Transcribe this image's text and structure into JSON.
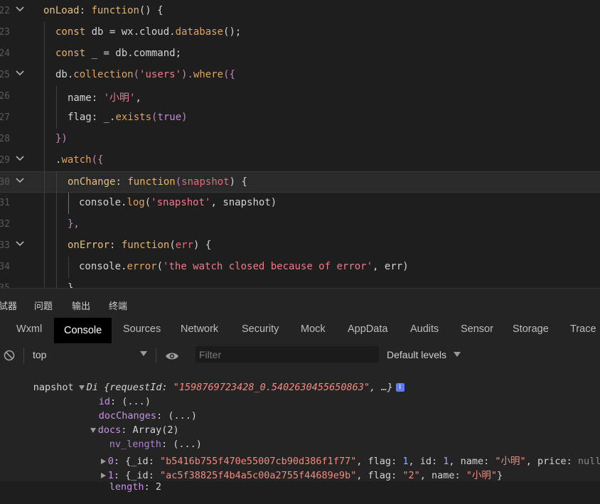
{
  "editor": {
    "lines": [
      {
        "num": "22",
        "fold": true
      },
      {
        "num": "23",
        "fold": false
      },
      {
        "num": "24",
        "fold": false
      },
      {
        "num": "25",
        "fold": true
      },
      {
        "num": "26",
        "fold": false
      },
      {
        "num": "27",
        "fold": false
      },
      {
        "num": "28",
        "fold": false
      },
      {
        "num": "29",
        "fold": true
      },
      {
        "num": "30",
        "fold": true
      },
      {
        "num": "31",
        "fold": false
      },
      {
        "num": "32",
        "fold": false
      },
      {
        "num": "33",
        "fold": true
      },
      {
        "num": "34",
        "fold": false
      },
      {
        "num": "35",
        "fold": false
      }
    ],
    "code": {
      "l22a": "onLoad",
      "l22b": ": ",
      "l22c": "function",
      "l22d": "() {",
      "l23a": "const",
      "l23b": " db = wx.cloud.",
      "l23c": "database",
      "l23d": "();",
      "l24a": "const",
      "l24b": " _ = db.command;",
      "l25a": "db.",
      "l25b": "collection",
      "l25c": "(",
      "l25d": "'users'",
      "l25e": ").",
      "l25f": "where",
      "l25g": "({",
      "l26a": "name: ",
      "l26b": "'小明'",
      "l26c": ",",
      "l27a": "flag: _.",
      "l27b": "exists",
      "l27c": "(",
      "l27d": "true",
      "l27e": ")",
      "l28a": "})",
      "l29a": ".",
      "l29b": "watch",
      "l29c": "({",
      "l30a": "onChange",
      "l30b": ": ",
      "l30c": "function",
      "l30d": "(",
      "l30e": "snapshot",
      "l30f": ") {",
      "l31a": "console.",
      "l31b": "log",
      "l31c": "(",
      "l31d": "'snapshot'",
      "l31e": ", snapshot)",
      "l32a": "},",
      "l33a": "onError",
      "l33b": ": ",
      "l33c": "function",
      "l33d": "(",
      "l33e": "err",
      "l33f": ") {",
      "l34a": "console.",
      "l34b": "error",
      "l34c": "(",
      "l34d": "'the watch closed because of error'",
      "l34e": ", err)",
      "l35a": "}"
    }
  },
  "panel": {
    "top_tabs": [
      "試器",
      "问题",
      "输出",
      "终端"
    ],
    "dev_tabs": [
      "Wxml",
      "Console",
      "Sources",
      "Network",
      "Security",
      "Mock",
      "AppData",
      "Audits",
      "Sensor",
      "Storage",
      "Trace"
    ],
    "context": "top",
    "filter_placeholder": "Filter",
    "levels": "Default levels"
  },
  "console": {
    "label": "napshot",
    "obj_head": "Di ",
    "obj_open": "{requestId: ",
    "request_id": "\"1598769723428_0.5402630455650863\"",
    "obj_tail": ", …}",
    "info": "i",
    "id_key": "id",
    "id_val": ": (...)",
    "dc_key": "docChanges",
    "dc_val": ": (...)",
    "docs_key": "docs",
    "docs_val": ": Array(2)",
    "nv_key": "nv_length",
    "nv_val": ": (...)",
    "d0_idx": "0",
    "d0_a": ": {_id: ",
    "d0_id": "\"b5416b755f470e55007cb90d386f1f77\"",
    "d0_b": ", flag: ",
    "d0_flag": "1",
    "d0_c": ", id: ",
    "d0_idv": "1",
    "d0_d": ", name: ",
    "d0_name": "\"小明\"",
    "d0_e": ", price: ",
    "d0_price": "null",
    "d0_f": "}",
    "d1_idx": "1",
    "d1_a": ": {_id: ",
    "d1_id": "\"ac5f38825f4b4a5c00a2755f44689e9b\"",
    "d1_b": ", flag: ",
    "d1_flag": "\"2\"",
    "d1_c": ", name: ",
    "d1_name": "\"小明\"",
    "d1_d": "}",
    "len_key": "length",
    "len_val": ": 2"
  }
}
